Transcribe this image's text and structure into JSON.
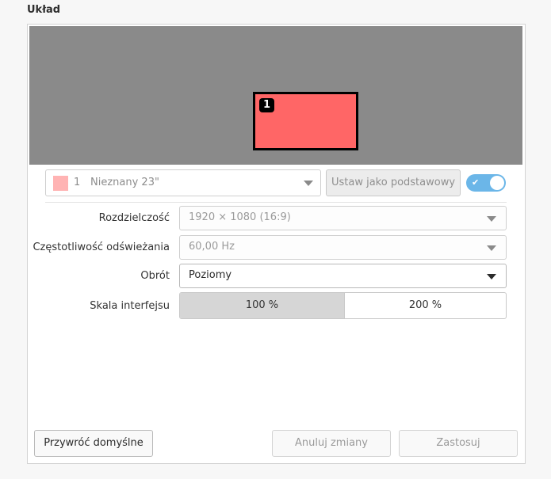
{
  "section": {
    "title": "Układ"
  },
  "preview": {
    "monitor_number": "1",
    "monitor_color": "#ff6666"
  },
  "monitor_select": {
    "number": "1",
    "name": "Nieznany 23\"",
    "swatch_color": "#ffb3b3"
  },
  "primary_button": {
    "label": "Ustaw jako podstawowy"
  },
  "toggle": {
    "state": "on",
    "color": "#6bb6e8"
  },
  "rows": {
    "resolution": {
      "label": "Rozdzielczość",
      "value": "1920 × 1080 (16:9)"
    },
    "refresh": {
      "label": "Częstotliwość odświeżania",
      "value": "60,00 Hz"
    },
    "rotation": {
      "label": "Obrót",
      "value": "Poziomy"
    },
    "scale": {
      "label": "Skala interfejsu",
      "options": [
        "100 %",
        "200 %"
      ],
      "selected": "100 %"
    }
  },
  "buttons": {
    "restore": "Przywróć domyślne",
    "cancel": "Anuluj zmiany",
    "apply": "Zastosuj"
  }
}
